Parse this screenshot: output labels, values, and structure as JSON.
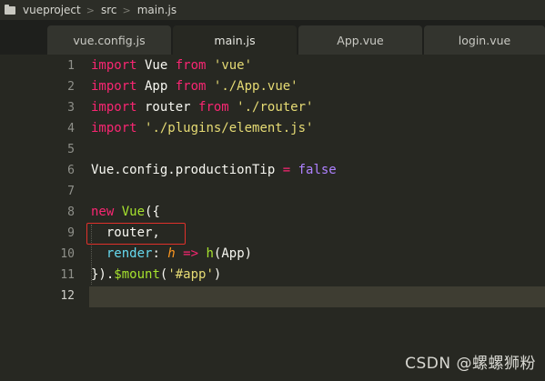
{
  "breadcrumb": {
    "icon": "folder-icon",
    "items": [
      "vueproject",
      "src",
      "main.js"
    ],
    "separator": ">"
  },
  "tabs": [
    {
      "label": "vue.config.js",
      "active": false
    },
    {
      "label": "main.js",
      "active": true
    },
    {
      "label": "App.vue",
      "active": false
    },
    {
      "label": "login.vue",
      "active": false
    }
  ],
  "editor": {
    "language": "javascript",
    "current_line": 12,
    "highlighted_line": 9,
    "colors": {
      "background": "#272822",
      "keyword": "#f92672",
      "string": "#e6db74",
      "class": "#a6e22e",
      "property": "#66d9ef",
      "constant": "#ae81ff",
      "parameter": "#fd971f",
      "highlight_box": "#e0312b"
    },
    "lines": [
      {
        "num": "1",
        "tokens": [
          [
            "kw",
            "import"
          ],
          [
            "white",
            " Vue "
          ],
          [
            "kw",
            "from"
          ],
          [
            "white",
            " "
          ],
          [
            "str",
            "'vue'"
          ]
        ]
      },
      {
        "num": "2",
        "tokens": [
          [
            "kw",
            "import"
          ],
          [
            "white",
            " App "
          ],
          [
            "kw",
            "from"
          ],
          [
            "white",
            " "
          ],
          [
            "str",
            "'./App.vue'"
          ]
        ]
      },
      {
        "num": "3",
        "tokens": [
          [
            "kw",
            "import"
          ],
          [
            "white",
            " router "
          ],
          [
            "kw",
            "from"
          ],
          [
            "white",
            " "
          ],
          [
            "str",
            "'./router'"
          ]
        ]
      },
      {
        "num": "4",
        "tokens": [
          [
            "kw",
            "import"
          ],
          [
            "white",
            " "
          ],
          [
            "str",
            "'./plugins/element.js'"
          ]
        ]
      },
      {
        "num": "5",
        "tokens": []
      },
      {
        "num": "6",
        "tokens": [
          [
            "white",
            "Vue.config.productionTip "
          ],
          [
            "kw",
            "="
          ],
          [
            "white",
            " "
          ],
          [
            "const",
            "false"
          ]
        ]
      },
      {
        "num": "7",
        "tokens": []
      },
      {
        "num": "8",
        "tokens": [
          [
            "kw",
            "new"
          ],
          [
            "white",
            " "
          ],
          [
            "cls",
            "Vue"
          ],
          [
            "white",
            "({"
          ]
        ]
      },
      {
        "num": "9",
        "tokens": [
          [
            "white",
            "  router,"
          ]
        ]
      },
      {
        "num": "10",
        "tokens": [
          [
            "white",
            "  "
          ],
          [
            "prop",
            "render"
          ],
          [
            "white",
            ": "
          ],
          [
            "param",
            "h"
          ],
          [
            "white",
            " "
          ],
          [
            "kw",
            "=>"
          ],
          [
            "white",
            " "
          ],
          [
            "cls",
            "h"
          ],
          [
            "white",
            "(App)"
          ]
        ]
      },
      {
        "num": "11",
        "tokens": [
          [
            "white",
            "})."
          ],
          [
            "cls",
            "$mount"
          ],
          [
            "white",
            "("
          ],
          [
            "str",
            "'#app'"
          ],
          [
            "white",
            ")"
          ]
        ]
      },
      {
        "num": "12",
        "tokens": []
      }
    ]
  },
  "watermark": "CSDN @螺螺狮粉"
}
